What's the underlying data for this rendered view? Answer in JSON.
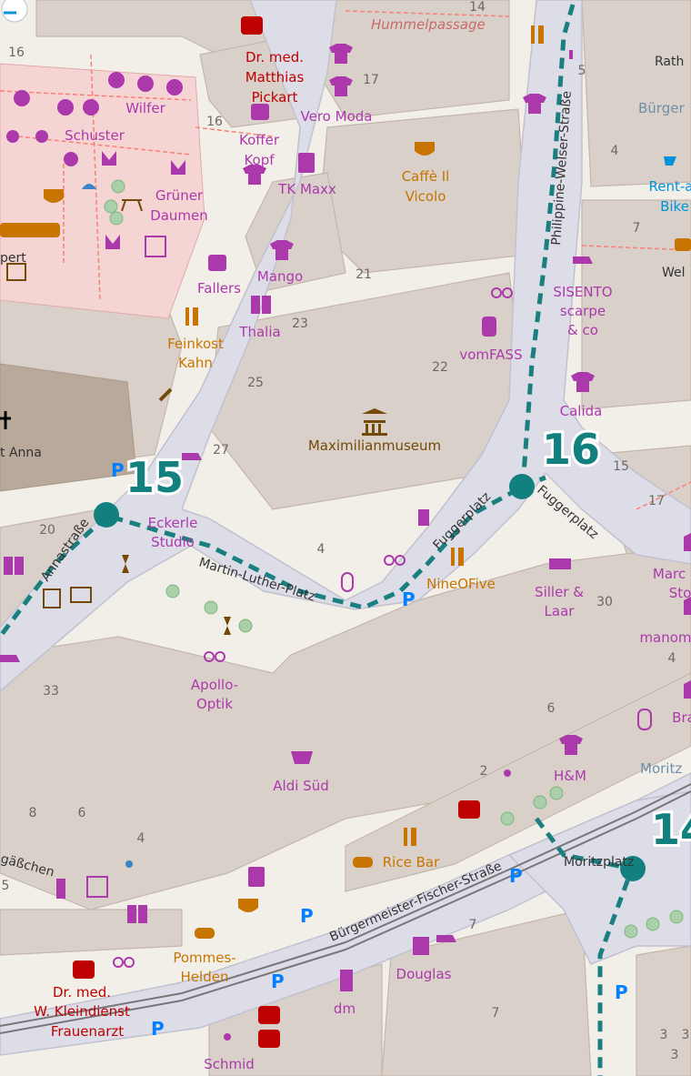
{
  "map": {
    "colors": {
      "background": "#f2efe9",
      "building": "#d9d0c9",
      "building_outline": "#c4b6ab",
      "pedestrian": "#dddde8",
      "pedestrian_outline": "#c1c1cf",
      "market_square": "#f5d4d4",
      "church": "#b8a99b",
      "route": "#1a7f7f",
      "shop_label": "#ac39ac",
      "food_label": "#c77400",
      "health": "#bf0000",
      "parking": "#0080ff",
      "tram": "#777777"
    },
    "route_stops": [
      {
        "label": "15"
      },
      {
        "label": "16"
      },
      {
        "label": "14"
      }
    ],
    "streets": [
      {
        "name": "Philippine-Welser-Straße"
      },
      {
        "name": "Annastraße"
      },
      {
        "name": "Martin-Luther-Platz"
      },
      {
        "name": "Fuggerplatz"
      },
      {
        "name": "Fuggerplatz"
      },
      {
        "name": "Bürgermeister-Fischer-Straße"
      },
      {
        "name": "Moritzplatz"
      },
      {
        "name": "Hummelpassage"
      },
      {
        "name": "gäßchen"
      },
      {
        "name": "Rath"
      },
      {
        "name": "Bürger"
      },
      {
        "name": "Wel"
      },
      {
        "name": "Moritz"
      },
      {
        "name": "t Anna"
      },
      {
        "name": "pert"
      }
    ],
    "poi_labels": [
      {
        "text": "Dr. med.",
        "kind": "health"
      },
      {
        "text": "Matthias",
        "kind": "health"
      },
      {
        "text": "Pickart",
        "kind": "health"
      },
      {
        "text": "Vero Moda",
        "kind": "shop"
      },
      {
        "text": "Wilfer",
        "kind": "shop"
      },
      {
        "text": "Schuster",
        "kind": "shop"
      },
      {
        "text": "Koffer",
        "kind": "shop"
      },
      {
        "text": "Kopf",
        "kind": "shop"
      },
      {
        "text": "TK Maxx",
        "kind": "shop"
      },
      {
        "text": "Caffè Il",
        "kind": "food"
      },
      {
        "text": "Vicolo",
        "kind": "food"
      },
      {
        "text": "Grüner",
        "kind": "shop"
      },
      {
        "text": "Daumen",
        "kind": "shop"
      },
      {
        "text": "Mango",
        "kind": "shop"
      },
      {
        "text": "Fallers",
        "kind": "shop"
      },
      {
        "text": "Thalia",
        "kind": "shop"
      },
      {
        "text": "Feinkost",
        "kind": "food"
      },
      {
        "text": "Kahn",
        "kind": "food"
      },
      {
        "text": "SISENTO",
        "kind": "shop"
      },
      {
        "text": "scarpe",
        "kind": "shop"
      },
      {
        "text": "& co",
        "kind": "shop"
      },
      {
        "text": "vomFASS",
        "kind": "shop"
      },
      {
        "text": "Calida",
        "kind": "shop"
      },
      {
        "text": "Maximilianmuseum",
        "kind": "amenity"
      },
      {
        "text": "Eckerle",
        "kind": "shop"
      },
      {
        "text": "Studio",
        "kind": "shop"
      },
      {
        "text": "NineOFive",
        "kind": "food"
      },
      {
        "text": "Siller &",
        "kind": "shop"
      },
      {
        "text": "Laar",
        "kind": "shop"
      },
      {
        "text": "Marc",
        "kind": "shop"
      },
      {
        "text": "Sto",
        "kind": "shop"
      },
      {
        "text": "manom",
        "kind": "shop"
      },
      {
        "text": "Apollo-",
        "kind": "shop"
      },
      {
        "text": "Optik",
        "kind": "shop"
      },
      {
        "text": "Aldi Süd",
        "kind": "shop"
      },
      {
        "text": "H&M",
        "kind": "shop"
      },
      {
        "text": "Rice Bar",
        "kind": "food"
      },
      {
        "text": "Pommes-",
        "kind": "food"
      },
      {
        "text": "Helden",
        "kind": "food"
      },
      {
        "text": "Douglas",
        "kind": "shop"
      },
      {
        "text": "dm",
        "kind": "shop"
      },
      {
        "text": "Dr. med.",
        "kind": "health"
      },
      {
        "text": "W. Kleindienst",
        "kind": "health"
      },
      {
        "text": "Frauenarzt",
        "kind": "health"
      },
      {
        "text": "Schmid",
        "kind": "shop"
      },
      {
        "text": "Rent-a",
        "kind": "amenity-blue"
      },
      {
        "text": "Bike",
        "kind": "amenity-blue"
      },
      {
        "text": "Bra",
        "kind": "shop"
      }
    ],
    "house_numbers": [
      "14",
      "16",
      "17",
      "16",
      "5",
      "4",
      "7",
      "21",
      "23",
      "22",
      "25",
      "27",
      "15",
      "17",
      "20",
      "4",
      "33",
      "30",
      "4",
      "6",
      "2",
      "8",
      "6",
      "4",
      "5",
      "7",
      "7",
      "3",
      "3",
      "3"
    ]
  }
}
